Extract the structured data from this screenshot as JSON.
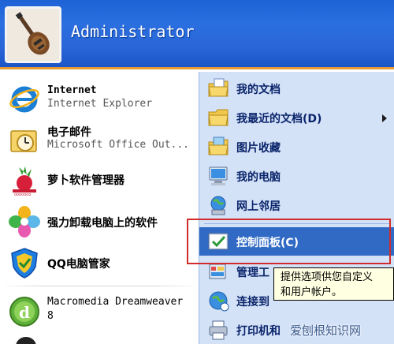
{
  "user": {
    "name": "Administrator"
  },
  "left_items": [
    {
      "title": "Internet",
      "subtitle": "Internet Explorer",
      "icon": "internet-explorer-icon"
    },
    {
      "title": "电子邮件",
      "subtitle": "Microsoft Office Out...",
      "icon": "outlook-icon"
    },
    {
      "title": "萝卜软件管理器",
      "icon": "radish-icon"
    },
    {
      "title": "强力卸载电脑上的软件",
      "icon": "uninstaller-icon"
    },
    {
      "title": "QQ电脑管家",
      "icon": "qq-pc-manager-icon"
    },
    {
      "title": "Macromedia Dreamweaver",
      "subtitle": "8",
      "icon": "dreamweaver-icon"
    }
  ],
  "right_items": [
    {
      "label": "我的文档",
      "icon": "my-documents-icon"
    },
    {
      "label": "我最近的文档(D)",
      "icon": "recent-documents-icon",
      "submenu": true
    },
    {
      "label": "图片收藏",
      "icon": "my-pictures-icon"
    },
    {
      "label": "我的电脑",
      "icon": "my-computer-icon"
    },
    {
      "label": "网上邻居",
      "icon": "network-places-icon"
    },
    {
      "label": "控制面板(C)",
      "icon": "control-panel-icon",
      "highlighted": true
    },
    {
      "label": "管理工",
      "icon": "admin-tools-icon"
    },
    {
      "label": "连接到",
      "icon": "connect-to-icon"
    },
    {
      "label": "打印机和",
      "icon": "printers-icon"
    }
  ],
  "tooltip": {
    "line1": "提供选项供您自定义",
    "line2": "和用户帐户。"
  },
  "watermark": "爱刨根知识网",
  "colors": {
    "header_blue": "#2a6fe0",
    "right_pane": "#d4e2f8",
    "highlight": "#316ac5",
    "annotation_red": "#d12b2b"
  }
}
